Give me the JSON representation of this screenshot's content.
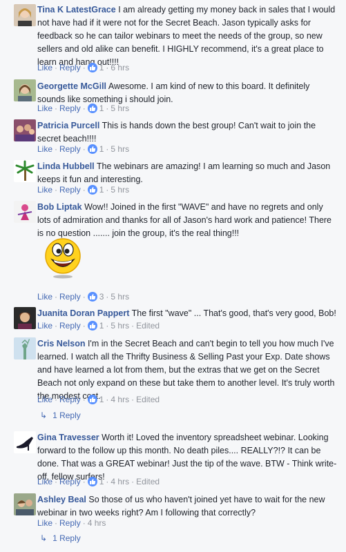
{
  "comments": [
    {
      "author": "Tina K LatestGrace",
      "text": "I am already getting my money back in sales that I would not have had if it were not for the Secret Beach. Jason typically asks for feedback so he can tailor webinars to meet the needs of the group, so new sellers and old alike can benefit. I HIGHLY recommend, it's a great place to learn and hang out!!!!",
      "like": "Like",
      "reply": "Reply",
      "likes": "1",
      "time": "6 hrs"
    },
    {
      "author": "Georgette McGill",
      "text": "Awesome. I am kind of new to this board. It definitely sounds like something i should join.",
      "like": "Like",
      "reply": "Reply",
      "likes": "1",
      "time": "5 hrs"
    },
    {
      "author": "Patricia Purcell",
      "text": "This is hands down the best group! Can't wait to join the secret beach!!!!",
      "like": "Like",
      "reply": "Reply",
      "likes": "1",
      "time": "5 hrs"
    },
    {
      "author": "Linda Hubbell",
      "text": "The webinars are amazing! I am learning so much and Jason keeps it fun and interesting.",
      "like": "Like",
      "reply": "Reply",
      "likes": "1",
      "time": "5 hrs"
    },
    {
      "author": "Bob Liptak",
      "text": "Wow!! Joined in the first \"WAVE\" and have no regrets and only lots of admiration and thanks for all of Jason's hard work and patience! There is no question ....... join the group, it's the real thing!!!",
      "like": "Like",
      "reply": "Reply",
      "likes": "3",
      "time": "5 hrs"
    },
    {
      "author": "Juanita Doran Pappert",
      "text": "The first \"wave\" ... That's good, that's very good, Bob!",
      "like": "Like",
      "reply": "Reply",
      "likes": "1",
      "time": "5 hrs",
      "edited": "Edited"
    },
    {
      "author": "Cris Nelson",
      "text": "I'm in the Secret Beach and can't begin to tell you how much I've learned. I watch all the Thrifty Business & Selling Past your Exp. Date shows and have learned a lot from them, but the extras that we get on the Secret Beach not only expand on these but take them to another level. It's truly worth the modest cost.",
      "like": "Like",
      "reply": "Reply",
      "likes": "1",
      "time": "4 hrs",
      "edited": "Edited",
      "replies_label": "1 Reply"
    },
    {
      "author": "Gina Travesser",
      "text": "Worth it! Loved the inventory spreadsheet webinar. Looking forward to the follow up this month. No death piles.... REALLY?!? It can be done. That was a GREAT webinar! Just the tip of the wave. BTW - Think write-off, fellow surfers!",
      "like": "Like",
      "reply": "Reply",
      "likes": "1",
      "time": "4 hrs",
      "edited": "Edited"
    },
    {
      "author": "Ashley Beal",
      "text": "So those of us who haven't joined yet have to wait for the new webinar in two weeks right? Am I following that correctly?",
      "like": "Like",
      "reply": "Reply",
      "time": "4 hrs",
      "replies_label": "1 Reply"
    }
  ],
  "separator": "·",
  "colors": {
    "link": "#4267b2",
    "author": "#365899",
    "meta": "#90949c",
    "like_badge": "#5890ff",
    "background": "#f6f7f9"
  }
}
